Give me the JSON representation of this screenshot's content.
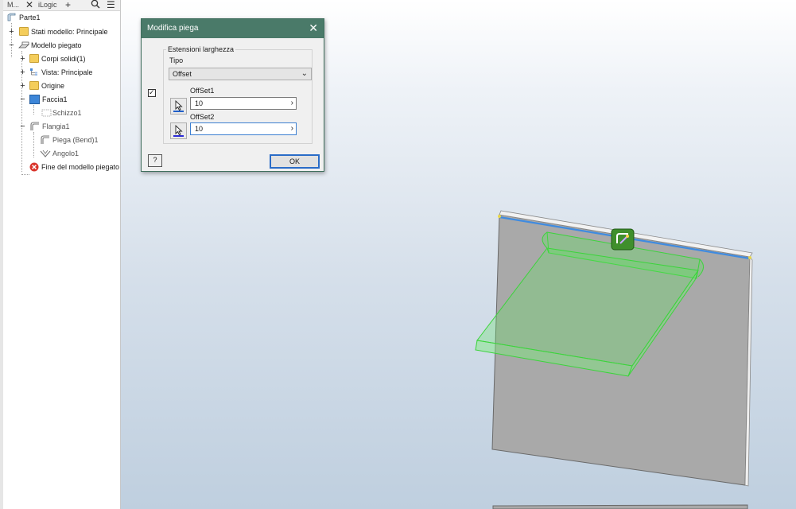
{
  "browser": {
    "tabs": [
      "M...",
      "iLogic"
    ],
    "tree": {
      "root": "Parte1",
      "items": [
        {
          "label": "Stati modello: Principale",
          "icon": "folder-icon",
          "expander": "+"
        },
        {
          "label": "Modello piegato",
          "icon": "sheet-metal-icon",
          "expander": "−"
        },
        {
          "label": "Corpi solidi(1)",
          "icon": "folder-icon",
          "expander": "+"
        },
        {
          "label": "Vista: Principale",
          "icon": "view-icon",
          "expander": "+"
        },
        {
          "label": "Origine",
          "icon": "folder-icon",
          "expander": "+"
        },
        {
          "label": "Faccia1",
          "icon": "face-icon",
          "expander": "−"
        },
        {
          "label": "Schizzo1",
          "icon": "sketch-icon",
          "expander": ""
        },
        {
          "label": "Flangia1",
          "icon": "flange-icon",
          "expander": "−"
        },
        {
          "label": "Piega (Bend)1",
          "icon": "bend-icon",
          "expander": ""
        },
        {
          "label": "Angolo1",
          "icon": "corner-icon",
          "expander": ""
        },
        {
          "label": "Fine del modello piegato",
          "icon": "end-of-part-icon",
          "expander": ""
        }
      ]
    }
  },
  "dialog": {
    "title": "Modifica piega",
    "group_label": "Estensioni larghezza",
    "tipo_label": "Tipo",
    "tipo_value": "Offset",
    "offset1_label": "OffSet1",
    "offset1_value": "10",
    "offset2_label": "OffSet2",
    "offset2_value": "10",
    "help_label": "?",
    "ok_label": "OK",
    "enabled_checked": true
  },
  "colors": {
    "dialog_title_bg": "#4a7a69",
    "preview_green": "#5ee35e",
    "edge_blue": "#3f8be0",
    "part_gray": "#a9a9a9"
  }
}
